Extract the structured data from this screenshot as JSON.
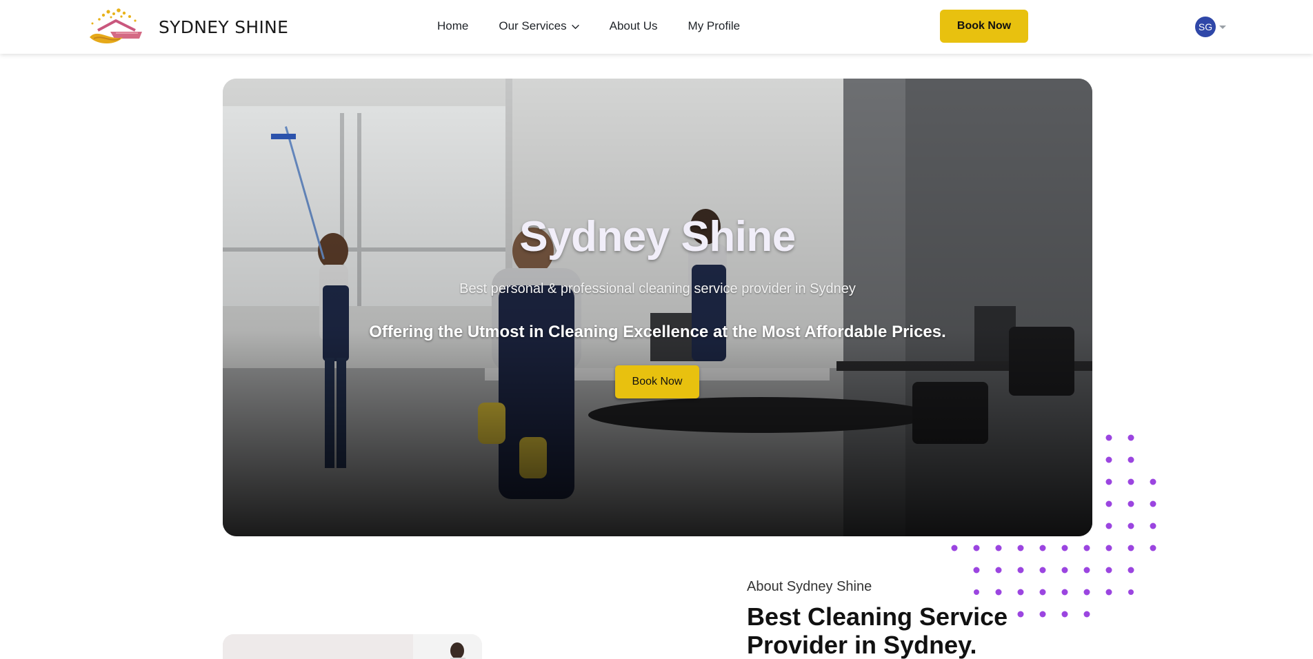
{
  "brand": {
    "name": "SYDNEY SHINE",
    "logo_icon": "house-sparkle-logo"
  },
  "nav": {
    "home": "Home",
    "services": "Our Services",
    "about": "About Us",
    "profile": "My Profile"
  },
  "header": {
    "book_label": "Book Now",
    "avatar_initials": "SG"
  },
  "hero": {
    "title": "Sydney Shine",
    "subtitle": "Best personal & professional cleaning service provider in Sydney",
    "tagline": "Offering the Utmost in Cleaning Excellence at the Most Affordable Prices.",
    "book_label": "Book Now"
  },
  "about": {
    "eyebrow": "About Sydney Shine",
    "title": "Best Cleaning Service Provider in Sydney."
  },
  "colors": {
    "accent_yellow": "#e8c10f",
    "avatar_blue": "#2f47a8",
    "dot_purple": "#9b45e0"
  }
}
